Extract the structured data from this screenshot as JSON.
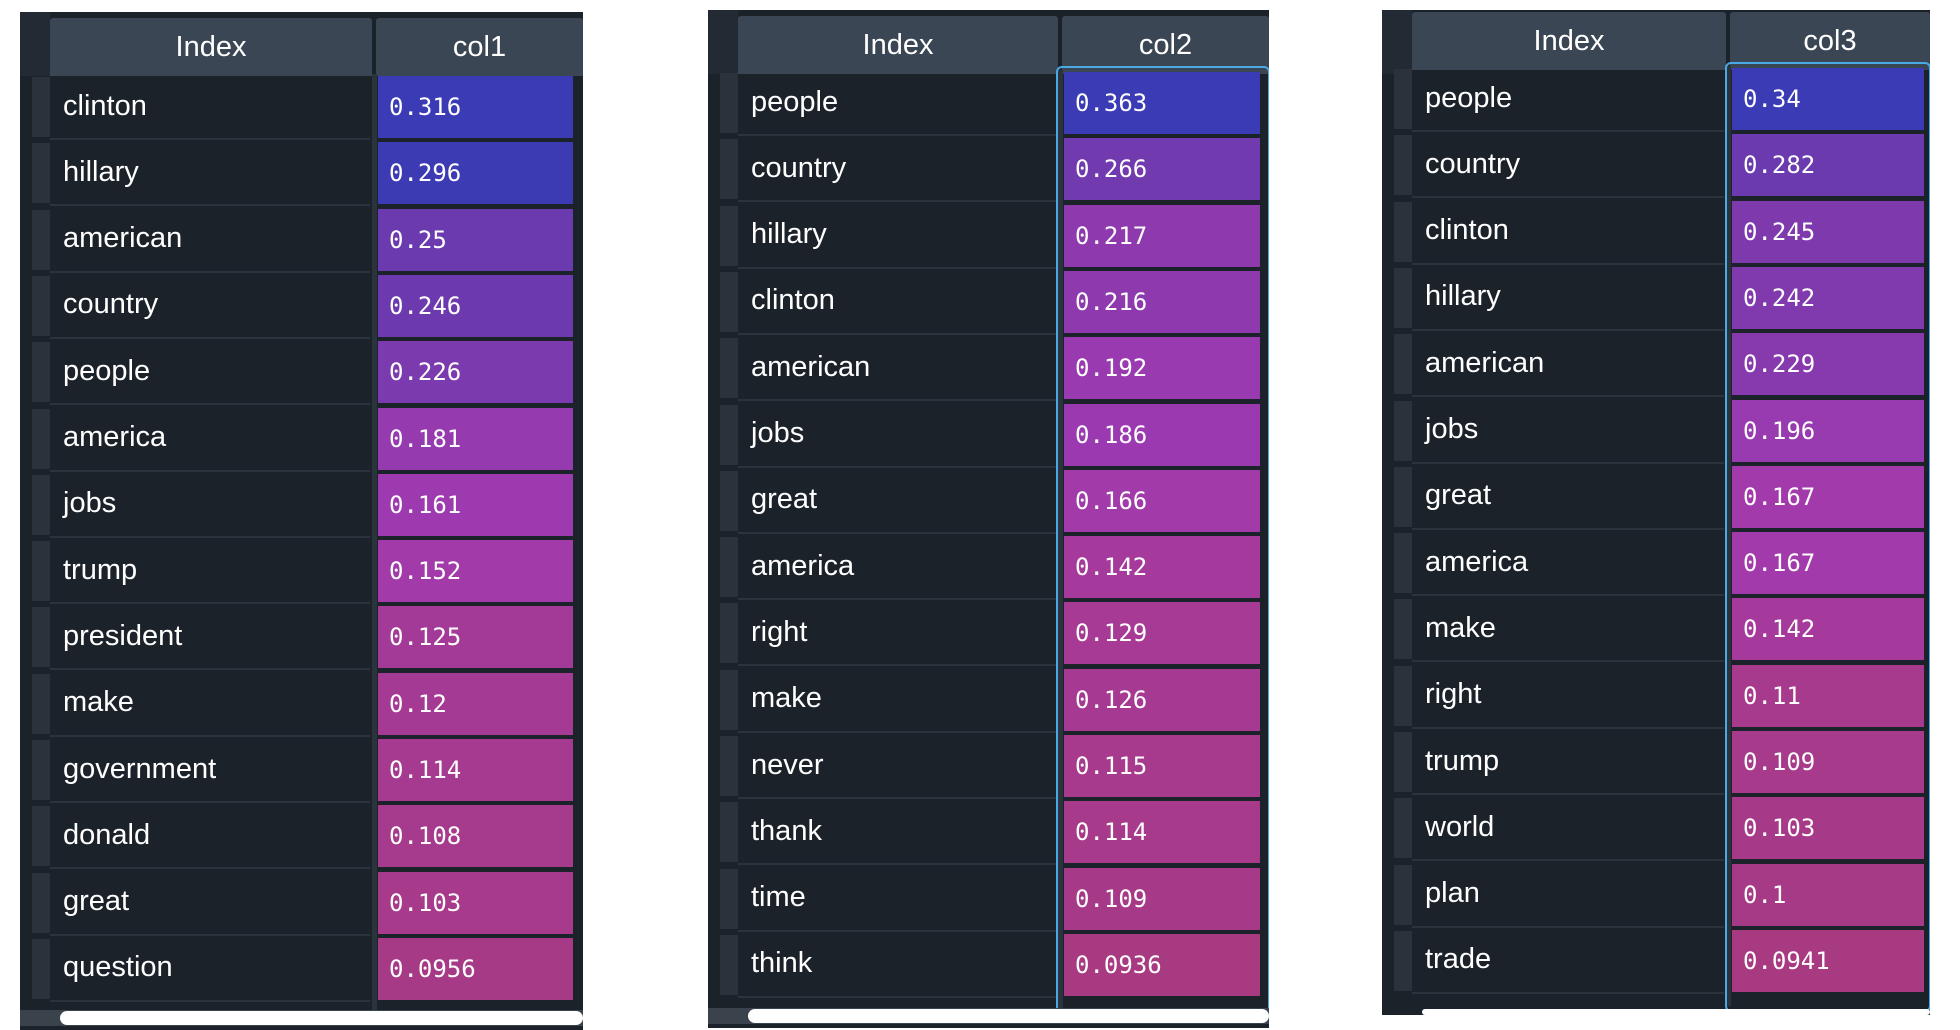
{
  "panels": [
    {
      "index_header": "Index",
      "col_header": "col1",
      "rows": [
        {
          "label": "clinton",
          "value": "0.316",
          "color": "#3a3bb5"
        },
        {
          "label": "hillary",
          "value": "0.296",
          "color": "#3d3bb3"
        },
        {
          "label": "american",
          "value": "0.25",
          "color": "#6a3aae"
        },
        {
          "label": "country",
          "value": "0.246",
          "color": "#6c3aae"
        },
        {
          "label": "people",
          "value": "0.226",
          "color": "#7b3aad"
        },
        {
          "label": "america",
          "value": "0.181",
          "color": "#963ab0"
        },
        {
          "label": "jobs",
          "value": "0.161",
          "color": "#9e3ab0"
        },
        {
          "label": "trump",
          "value": "0.152",
          "color": "#a23aaa"
        },
        {
          "label": "president",
          "value": "0.125",
          "color": "#a43a98"
        },
        {
          "label": "make",
          "value": "0.12",
          "color": "#a53a94"
        },
        {
          "label": "government",
          "value": "0.114",
          "color": "#a63a90"
        },
        {
          "label": "donald",
          "value": "0.108",
          "color": "#a63a8c"
        },
        {
          "label": "great",
          "value": "0.103",
          "color": "#a73a8a"
        },
        {
          "label": "question",
          "value": "0.0956",
          "color": "#a73a86"
        }
      ]
    },
    {
      "index_header": "Index",
      "col_header": "col2",
      "rows": [
        {
          "label": "people",
          "value": "0.363",
          "color": "#3a3bb5"
        },
        {
          "label": "country",
          "value": "0.266",
          "color": "#713aae"
        },
        {
          "label": "hillary",
          "value": "0.217",
          "color": "#8e3aae"
        },
        {
          "label": "clinton",
          "value": "0.216",
          "color": "#8e3aae"
        },
        {
          "label": "american",
          "value": "0.192",
          "color": "#993ab0"
        },
        {
          "label": "jobs",
          "value": "0.186",
          "color": "#9b3ab0"
        },
        {
          "label": "great",
          "value": "0.166",
          "color": "#a23aaa"
        },
        {
          "label": "america",
          "value": "0.142",
          "color": "#a53a9c"
        },
        {
          "label": "right",
          "value": "0.129",
          "color": "#a63a94"
        },
        {
          "label": "make",
          "value": "0.126",
          "color": "#a63a92"
        },
        {
          "label": "never",
          "value": "0.115",
          "color": "#a73a8c"
        },
        {
          "label": "thank",
          "value": "0.114",
          "color": "#a73a8b"
        },
        {
          "label": "time",
          "value": "0.109",
          "color": "#a73a88"
        },
        {
          "label": "think",
          "value": "0.0936",
          "color": "#a83a82"
        }
      ]
    },
    {
      "index_header": "Index",
      "col_header": "col3",
      "rows": [
        {
          "label": "people",
          "value": "0.34",
          "color": "#3a3bb5"
        },
        {
          "label": "country",
          "value": "0.282",
          "color": "#6a3aae"
        },
        {
          "label": "clinton",
          "value": "0.245",
          "color": "#7e3aad"
        },
        {
          "label": "hillary",
          "value": "0.242",
          "color": "#803aad"
        },
        {
          "label": "american",
          "value": "0.229",
          "color": "#873aad"
        },
        {
          "label": "jobs",
          "value": "0.196",
          "color": "#983ab0"
        },
        {
          "label": "great",
          "value": "0.167",
          "color": "#a33aac"
        },
        {
          "label": "america",
          "value": "0.167",
          "color": "#a33aac"
        },
        {
          "label": "make",
          "value": "0.142",
          "color": "#a53a9c"
        },
        {
          "label": "right",
          "value": "0.11",
          "color": "#a73a8c"
        },
        {
          "label": "trump",
          "value": "0.109",
          "color": "#a73a8b"
        },
        {
          "label": "world",
          "value": "0.103",
          "color": "#a73a88"
        },
        {
          "label": "plan",
          "value": "0.1",
          "color": "#a73a86"
        },
        {
          "label": "trade",
          "value": "0.0941",
          "color": "#a83a82"
        }
      ]
    }
  ]
}
